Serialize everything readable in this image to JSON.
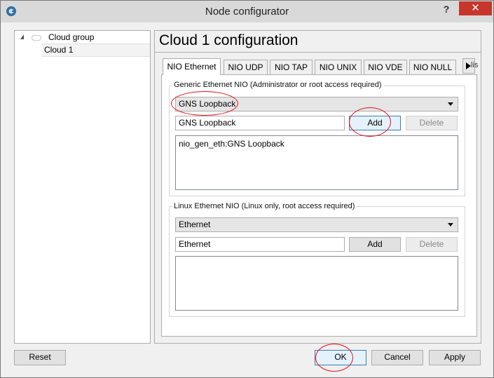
{
  "window": {
    "title": "Node configurator",
    "help_label": "?",
    "close_label": "✕"
  },
  "tree": {
    "group_label": "Cloud group",
    "item_label": "Cloud 1"
  },
  "config": {
    "title": "Cloud 1 configuration"
  },
  "tabs": [
    {
      "label": "NIO Ethernet"
    },
    {
      "label": "NIO UDP"
    },
    {
      "label": "NIO TAP"
    },
    {
      "label": "NIO UNIX"
    },
    {
      "label": "NIO VDE"
    },
    {
      "label": "NIO NULL"
    }
  ],
  "tab_overflow": {
    "partial_label": "lis"
  },
  "generic": {
    "group_label": "Generic Ethernet NIO (Administrator or root access required)",
    "combo_value": "GNS Loopback",
    "field_value": "GNS Loopback",
    "add_label": "Add",
    "delete_label": "Delete",
    "list_items": [
      "nio_gen_eth:GNS Loopback"
    ]
  },
  "linux": {
    "group_label": "Linux Ethernet NIO (Linux only, root access required)",
    "combo_value": "Ethernet",
    "field_value": "Ethernet",
    "add_label": "Add",
    "delete_label": "Delete"
  },
  "footer": {
    "reset_label": "Reset",
    "ok_label": "OK",
    "cancel_label": "Cancel",
    "apply_label": "Apply"
  },
  "colors": {
    "annotation": "#e3111a",
    "close_button": "#c7362b"
  }
}
